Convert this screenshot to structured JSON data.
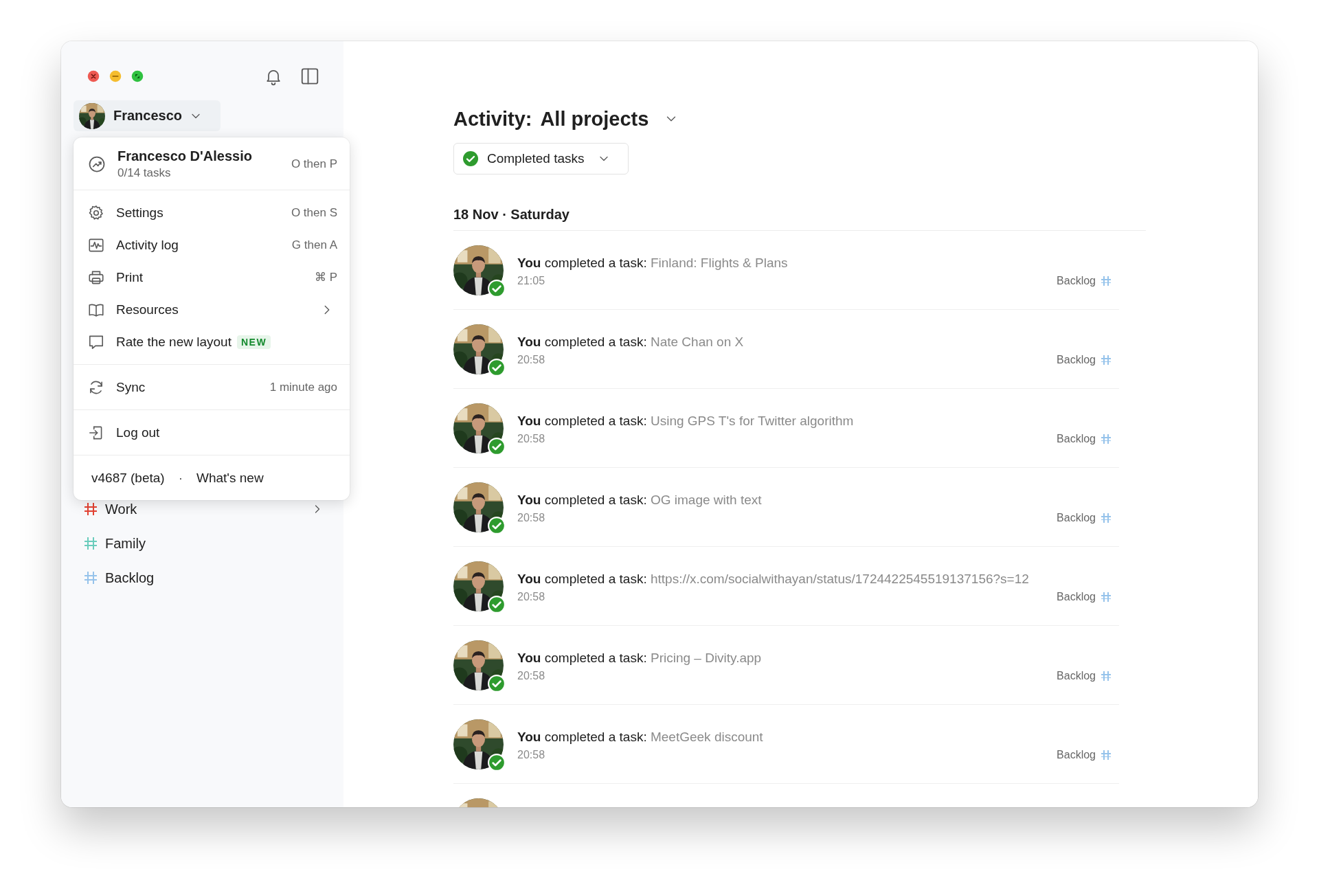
{
  "sidebar": {
    "profile": {
      "name": "Francesco"
    },
    "projects": [
      {
        "name": "Work",
        "color": "#e44232",
        "kind": "parent"
      },
      {
        "name": "Family",
        "color": "#6accbc",
        "kind": "leaf"
      },
      {
        "name": "Backlog",
        "color": "#96c3eb",
        "kind": "leaf"
      }
    ]
  },
  "account_menu": {
    "header": {
      "name": "Francesco D'Alessio",
      "tasks": "0/14 tasks",
      "shortcut": "O then P"
    },
    "sections": [
      [
        {
          "kind": "settings",
          "label": "Settings",
          "shortcut": "O then S"
        },
        {
          "kind": "activity-log",
          "label": "Activity log",
          "shortcut": "G then A"
        },
        {
          "kind": "print",
          "label": "Print",
          "shortcut": "⌘ P"
        },
        {
          "kind": "resources",
          "label": "Resources",
          "submenu": true
        },
        {
          "kind": "feedback",
          "label": "Rate the new layout",
          "badge": "NEW"
        }
      ],
      [
        {
          "kind": "sync",
          "label": "Sync",
          "status": "1 minute ago"
        }
      ],
      [
        {
          "kind": "logout",
          "label": "Log out"
        }
      ]
    ],
    "footer": {
      "version": "v4687 (beta)",
      "separator": "·",
      "link": "What's new"
    }
  },
  "main": {
    "title": "Activity:",
    "scope": "All projects",
    "filter": "Completed tasks",
    "groups": [
      {
        "date": "18 Nov · Saturday",
        "items": [
          {
            "actor": "You",
            "action": "completed a task:",
            "task": "Finland: Flights & Plans",
            "time": "21:05",
            "project": {
              "name": "Backlog",
              "color": "#96c3eb"
            }
          },
          {
            "actor": "You",
            "action": "completed a task:",
            "task": "Nate Chan on X",
            "time": "20:58",
            "project": {
              "name": "Backlog",
              "color": "#96c3eb"
            }
          },
          {
            "actor": "You",
            "action": "completed a task:",
            "task": "Using GPS T's for Twitter algorithm",
            "time": "20:58",
            "project": {
              "name": "Backlog",
              "color": "#96c3eb"
            }
          },
          {
            "actor": "You",
            "action": "completed a task:",
            "task": "OG image with text",
            "time": "20:58",
            "project": {
              "name": "Backlog",
              "color": "#96c3eb"
            }
          },
          {
            "actor": "You",
            "action": "completed a task:",
            "task": "https://x.com/socialwithayan/status/1724422545519137156?s=12",
            "time": "20:58",
            "project": {
              "name": "Backlog",
              "color": "#96c3eb"
            }
          },
          {
            "actor": "You",
            "action": "completed a task:",
            "task": "Pricing – Divity.app",
            "time": "20:58",
            "project": {
              "name": "Backlog",
              "color": "#96c3eb"
            }
          },
          {
            "actor": "You",
            "action": "completed a task:",
            "task": "MeetGeek discount",
            "time": "20:58",
            "project": {
              "name": "Backlog",
              "color": "#96c3eb"
            }
          }
        ]
      }
    ]
  }
}
